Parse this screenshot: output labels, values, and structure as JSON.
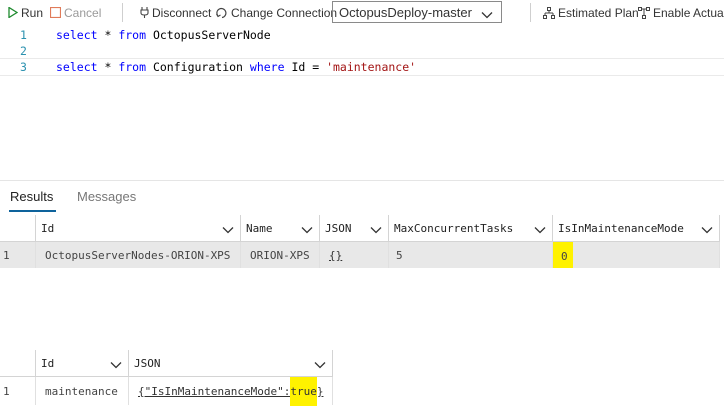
{
  "toolbar": {
    "run_label": "Run",
    "cancel_label": "Cancel",
    "disconnect_label": "Disconnect",
    "change_connection_label": "Change Connection",
    "database": "OctopusDeploy-master",
    "estimated_plan_label": "Estimated Plan",
    "enable_actual_label": "Enable Actual I"
  },
  "editor": {
    "lines": [
      {
        "num": "1",
        "code": "select * from OctopusServerNode"
      },
      {
        "num": "2",
        "code": ""
      },
      {
        "num": "3",
        "code": "select * from Configuration where Id = 'maintenance'"
      }
    ],
    "line1": {
      "kw1": "select",
      "rest1": " * ",
      "kw2": "from",
      "rest2": " OctopusServerNode"
    },
    "line3": {
      "kw1": "select",
      "rest1": " * ",
      "kw2": "from",
      "rest2": " Configuration ",
      "kw3": "where",
      "rest3": " Id = ",
      "str": "'maintenance'"
    }
  },
  "results": {
    "tabs": [
      "Results",
      "Messages"
    ],
    "grid1": {
      "columns": [
        "Id",
        "Name",
        "JSON",
        "MaxConcurrentTasks",
        "IsInMaintenanceMode"
      ],
      "rows": [
        {
          "num": "1",
          "cells": [
            "OctopusServerNodes-ORION-XPS",
            "ORION-XPS",
            "{}",
            "5",
            "0"
          ]
        }
      ]
    },
    "grid2": {
      "columns": [
        "Id",
        "JSON"
      ],
      "rows": [
        {
          "num": "1",
          "id": "maintenance",
          "json_prefix": "{\"IsInMaintenanceMode\":",
          "json_value": "true",
          "json_suffix": "}"
        }
      ]
    }
  },
  "colors": {
    "keyword": "#0000ff",
    "string": "#a31515",
    "line_number": "#2b91af",
    "highlight": "#fff200",
    "tab_accent": "#0e639c"
  },
  "icons": [
    "play-icon",
    "stop-icon",
    "disconnect-icon",
    "change-connection-icon",
    "estimated-plan-icon",
    "actual-plan-icon",
    "chevron-down-icon"
  ]
}
